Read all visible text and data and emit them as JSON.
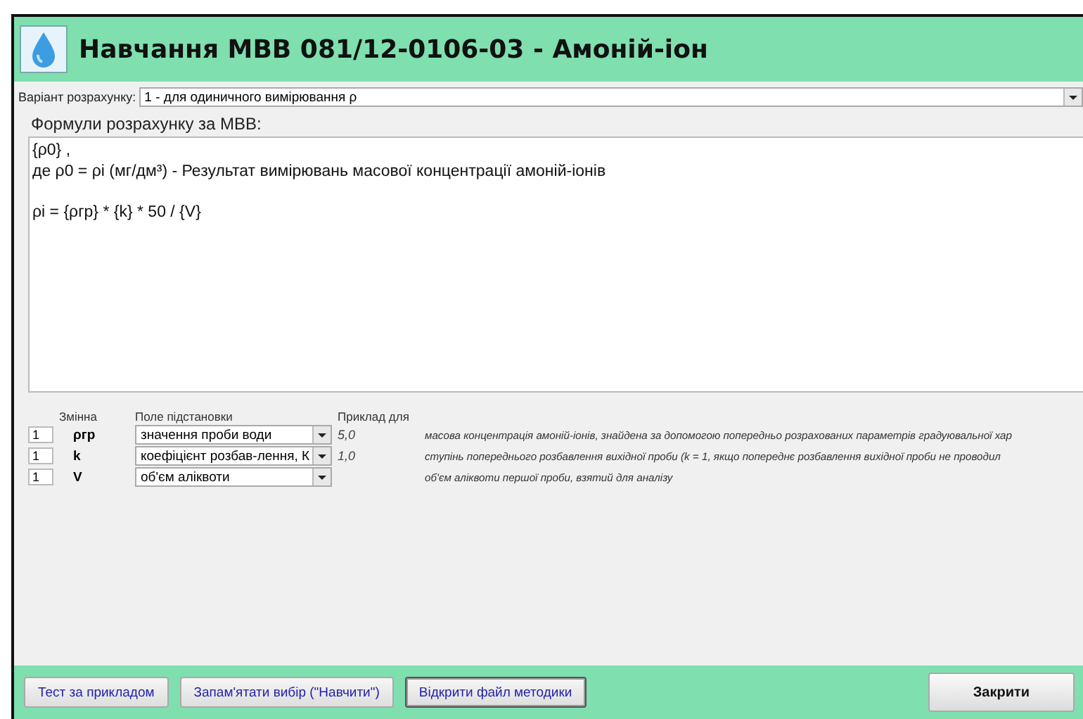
{
  "window": {
    "title": "Навчання МВВ 081/12-0106-03 - Амоній-іон"
  },
  "variant": {
    "label": "Варіант розрахунку:",
    "value": "1 - для одиничного вимірювання ρ"
  },
  "formulas": {
    "label": "Формули розрахунку за МВВ:",
    "lines": [
      "{ρ0} ,",
      "де ρ0 = ρі (мг/дм³) - Результат вимірювань масової концентрації амоній-іонів"
    ],
    "formula": "ρі = {ρгр} * {k} * 50 / {V}"
  },
  "table": {
    "columns": [
      "Змінна",
      "Поле підстановки",
      "Приклад для"
    ],
    "rows": [
      {
        "count": "1",
        "variable": "ρгр",
        "field": "значення проби води",
        "example": "5,0",
        "description": "масова концентрація амоній-іонів, знайдена за допомогою попередньо розрахованих параметрів градуювальної хар"
      },
      {
        "count": "1",
        "variable": "k",
        "field": "коефіцієнт розбав-лення, К",
        "example": "1,0",
        "description": "ступінь попереднього розбавлення вихідної проби (k = 1, якщо попереднє розбавлення вихідної проби не проводил"
      },
      {
        "count": "1",
        "variable": "V",
        "field": "об'єм аліквоти",
        "description": "об'єм аліквоти першої проби, взятий для аналізу"
      }
    ]
  },
  "buttons": [
    {
      "label": "Тест за прикладом",
      "focused": false
    },
    {
      "label": "Запам'ятати вибір (\"Навчити\")",
      "focused": false
    },
    {
      "label": "Відкрити файл методики",
      "focused": true
    }
  ],
  "close_button": "Закрити"
}
